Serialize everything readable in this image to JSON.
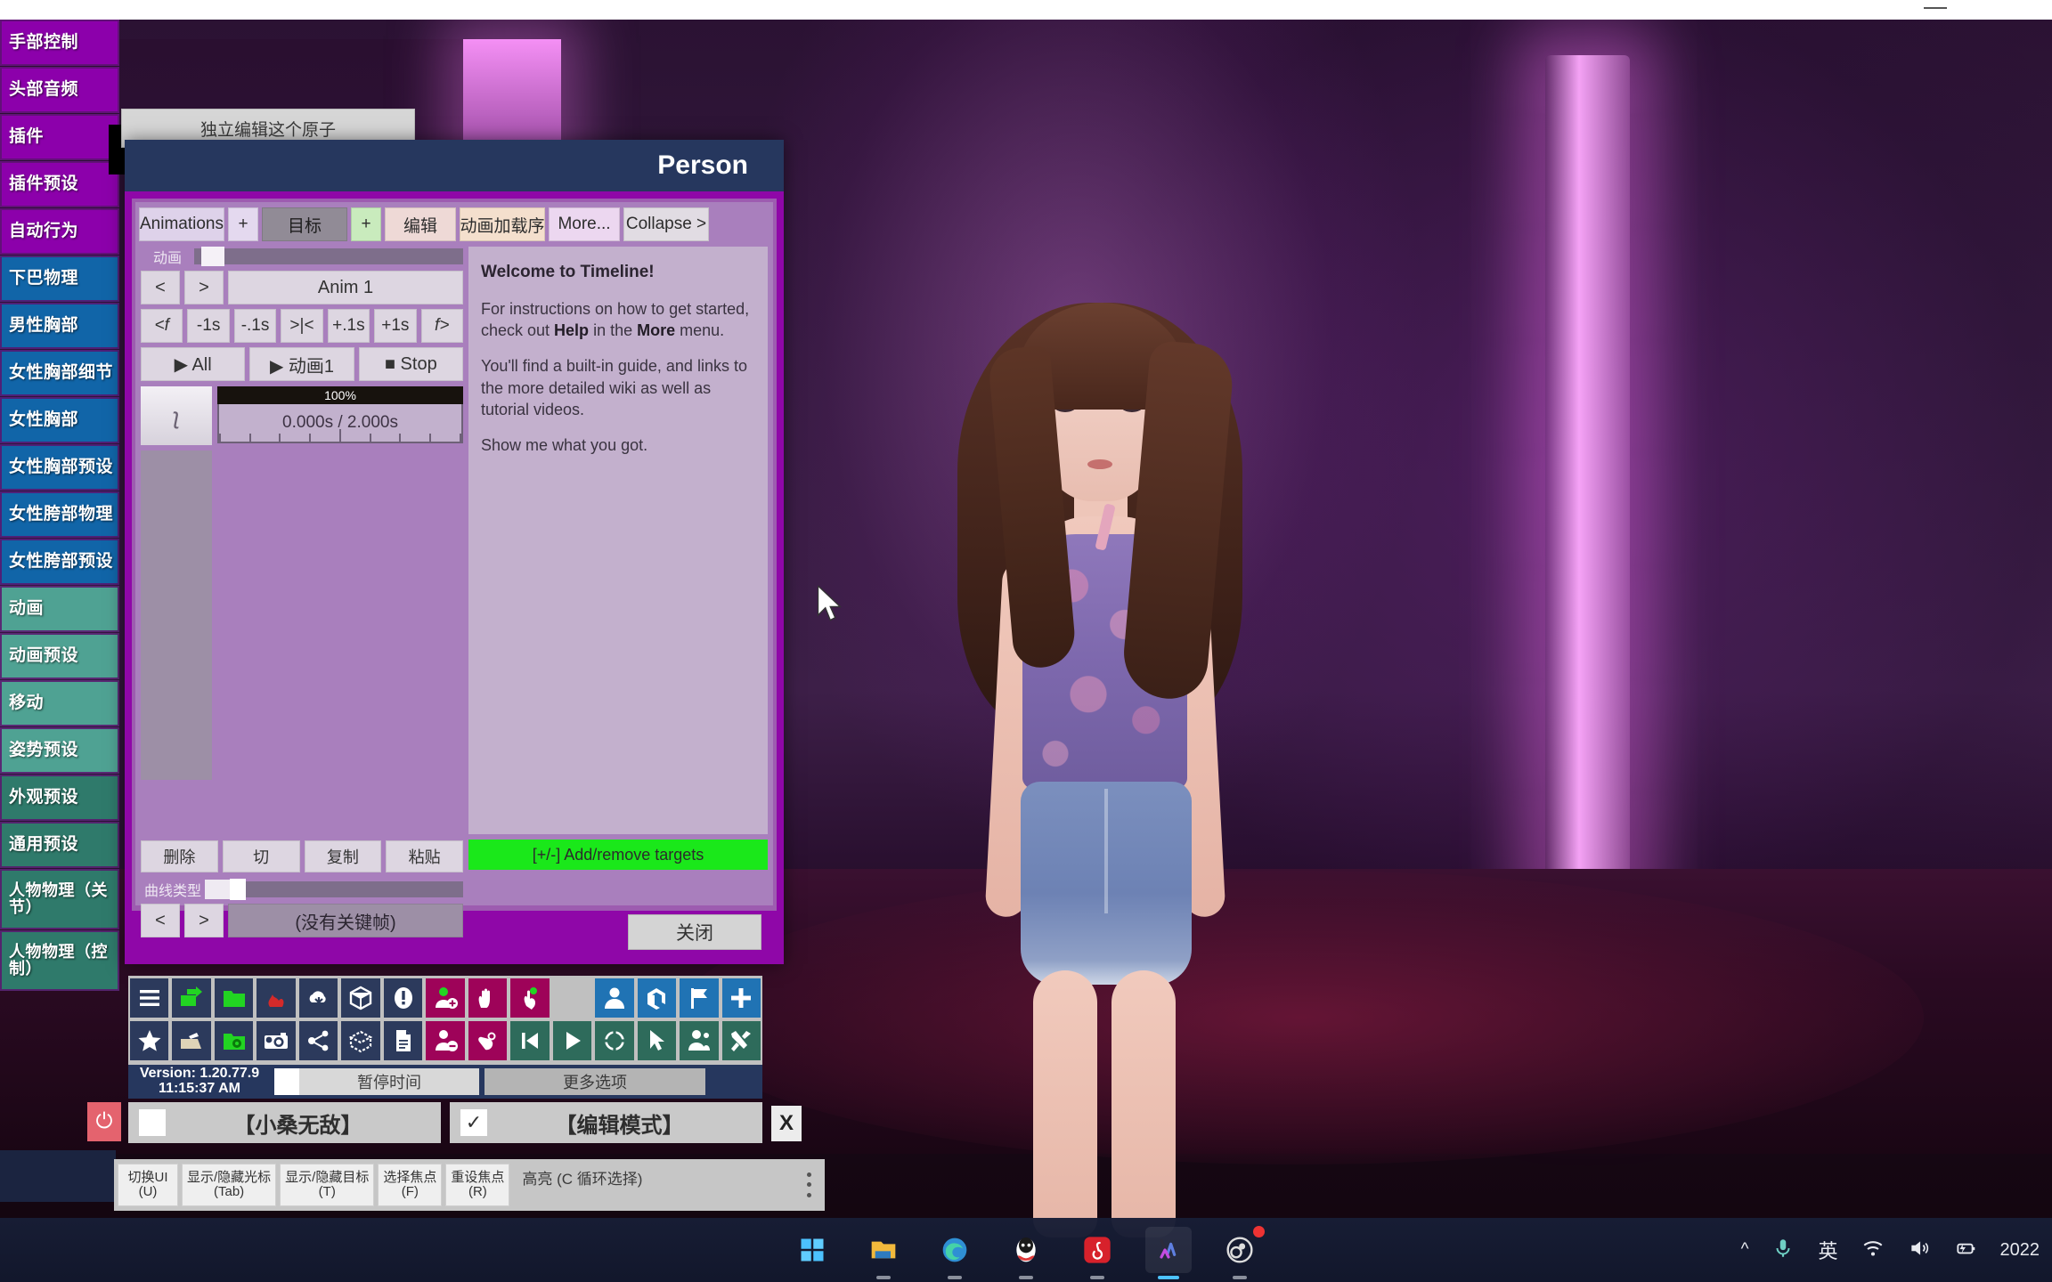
{
  "window": {
    "minimize_glyph": "—"
  },
  "sidebar": {
    "items": [
      {
        "label": "手部控制",
        "color": "purple"
      },
      {
        "label": "头部音频",
        "color": "purple"
      },
      {
        "label": "插件",
        "color": "purple"
      },
      {
        "label": "插件预设",
        "color": "purple"
      },
      {
        "label": "自动行为",
        "color": "purple"
      },
      {
        "label": "下巴物理",
        "color": "blue"
      },
      {
        "label": "男性胸部",
        "color": "blue"
      },
      {
        "label": "女性胸部细节",
        "color": "blue"
      },
      {
        "label": "女性胸部",
        "color": "blue"
      },
      {
        "label": "女性胸部预设",
        "color": "blue"
      },
      {
        "label": "女性胯部物理",
        "color": "blue"
      },
      {
        "label": "女性胯部预设",
        "color": "blue"
      },
      {
        "label": "动画",
        "color": "teal"
      },
      {
        "label": "动画预设",
        "color": "teal"
      },
      {
        "label": "移动",
        "color": "teal"
      },
      {
        "label": "姿势预设",
        "color": "teal"
      },
      {
        "label": "外观预设",
        "color": "teal2"
      },
      {
        "label": "通用预设",
        "color": "teal2"
      },
      {
        "label": "人物物理（关节）",
        "color": "teal2",
        "two_line": true
      },
      {
        "label": "人物物理（控制）",
        "color": "teal2",
        "two_line": true
      }
    ]
  },
  "independent_edit_button": "独立编辑这个原子",
  "panel": {
    "title": "Person",
    "toolbar": {
      "animations": "Animations",
      "plus_1": "+",
      "target": "目标",
      "plus_2": "+",
      "edit": "编辑",
      "load_sequence": "动画加载序",
      "more": "More...",
      "collapse": "Collapse >"
    },
    "anim_label": "动画",
    "nav_prev": "<",
    "nav_next": ">",
    "anim_name": "Anim 1",
    "frame_buttons": [
      "<f",
      "-1s",
      "-.1s",
      ">|<",
      "+.1s",
      "+1s",
      "f>"
    ],
    "play_all": "▶ All",
    "play_anim": "▶ 动画1",
    "stop": "■ Stop",
    "speed_percent": "100%",
    "time_display": "0.000s / 2.000s",
    "curve_icon": "ʅ",
    "welcome": {
      "heading": "Welcome to Timeline!",
      "p1_a": "For instructions on how to get started, check out ",
      "p1_b": "Help",
      "p1_c": " in the ",
      "p1_d": "More",
      "p1_e": " menu.",
      "p2": "You'll find a built-in guide, and links to the more detailed wiki as well as tutorial videos.",
      "p3": "Show me what you got."
    },
    "clipboard_buttons": [
      "删除",
      "切",
      "复制",
      "粘贴"
    ],
    "curve_type_label": "曲线类型",
    "no_keyframe": "(没有关键帧)",
    "add_remove_targets": "[+/-] Add/remove targets",
    "close_button": "关闭"
  },
  "icon_bar": {
    "row1": [
      {
        "name": "hamburger-menu-icon",
        "color": "navy",
        "glyph": "menu"
      },
      {
        "name": "load-scene-icon",
        "color": "navy",
        "glyph": "load"
      },
      {
        "name": "folder-icon",
        "color": "navy",
        "glyph": "folder"
      },
      {
        "name": "flame-icon",
        "color": "navy",
        "glyph": "flame"
      },
      {
        "name": "cloud-download-icon",
        "color": "navy",
        "glyph": "cloud"
      },
      {
        "name": "package-icon",
        "color": "navy",
        "glyph": "box"
      },
      {
        "name": "alert-icon",
        "color": "navy",
        "glyph": "alert"
      },
      {
        "name": "add-person-icon",
        "color": "magenta",
        "glyph": "person-plus"
      },
      {
        "name": "hand-icon",
        "color": "magenta",
        "glyph": "hand"
      },
      {
        "name": "touch-icon",
        "color": "magenta",
        "glyph": "touch"
      },
      {
        "name": "spacer",
        "color": "gap",
        "glyph": ""
      },
      {
        "name": "person-icon",
        "color": "bluec",
        "glyph": "person"
      },
      {
        "name": "unity-icon",
        "color": "bluec",
        "glyph": "unity"
      },
      {
        "name": "flag-icon",
        "color": "bluec",
        "glyph": "flag"
      },
      {
        "name": "plus-icon",
        "color": "bluec",
        "glyph": "plus"
      }
    ],
    "row2": [
      {
        "name": "star-icon",
        "color": "navy",
        "glyph": "star"
      },
      {
        "name": "save-scene-icon",
        "color": "navy",
        "glyph": "save"
      },
      {
        "name": "folder-settings-icon",
        "color": "navy",
        "glyph": "folder-gear"
      },
      {
        "name": "camera-icon",
        "color": "navy",
        "glyph": "camera"
      },
      {
        "name": "node-graph-icon",
        "color": "navy",
        "glyph": "nodes"
      },
      {
        "name": "open-package-icon",
        "color": "navy",
        "glyph": "open-box"
      },
      {
        "name": "document-icon",
        "color": "navy",
        "glyph": "doc"
      },
      {
        "name": "remove-person-icon",
        "color": "magenta",
        "glyph": "person-minus"
      },
      {
        "name": "grab-icon",
        "color": "magenta",
        "glyph": "grab"
      },
      {
        "name": "skip-back-icon",
        "color": "greenc",
        "glyph": "skip-back"
      },
      {
        "name": "play-icon",
        "color": "greenc",
        "glyph": "play"
      },
      {
        "name": "target-icon",
        "color": "greenc",
        "glyph": "target"
      },
      {
        "name": "pointer-icon",
        "color": "greenc",
        "glyph": "pointer"
      },
      {
        "name": "person-edit-icon",
        "color": "greenc",
        "glyph": "person-edit"
      },
      {
        "name": "tools-icon",
        "color": "greenc",
        "glyph": "tools"
      }
    ]
  },
  "status_bar": {
    "version": "Version: 1.20.77.9",
    "time": "11:15:37 AM",
    "pause_time": "暂停时间",
    "more_options": "更多选项"
  },
  "toggles": [
    {
      "label": "【小桑无敌】",
      "checked": false,
      "check_glyph": ""
    },
    {
      "label": "【编辑模式】",
      "checked": true,
      "check_glyph": "✓"
    }
  ],
  "power_button": "⏻",
  "close_x": "X",
  "hint_bar": {
    "hints": [
      {
        "line1": "切换UI",
        "line2": "(U)"
      },
      {
        "line1": "显示/隐藏光标",
        "line2": "(Tab)"
      },
      {
        "line1": "显示/隐藏目标",
        "line2": "(T)"
      },
      {
        "line1": "选择焦点",
        "line2": "(F)"
      },
      {
        "line1": "重设焦点",
        "line2": "(R)"
      }
    ],
    "note": "高亮 (C 循环选择)"
  },
  "taskbar": {
    "items": [
      {
        "name": "start-button",
        "active": false
      },
      {
        "name": "file-explorer",
        "active": false
      },
      {
        "name": "microsoft-edge",
        "active": false
      },
      {
        "name": "qq",
        "active": false
      },
      {
        "name": "netease-music",
        "active": false
      },
      {
        "name": "vam-app",
        "active": true
      },
      {
        "name": "obs-studio",
        "active": false
      }
    ],
    "tray": {
      "chevron": "^",
      "mic": "microphone-icon",
      "ime": "英",
      "wifi": "wifi-icon",
      "volume": "volume-icon",
      "battery": "battery-charging-icon",
      "clock": "2022"
    }
  }
}
